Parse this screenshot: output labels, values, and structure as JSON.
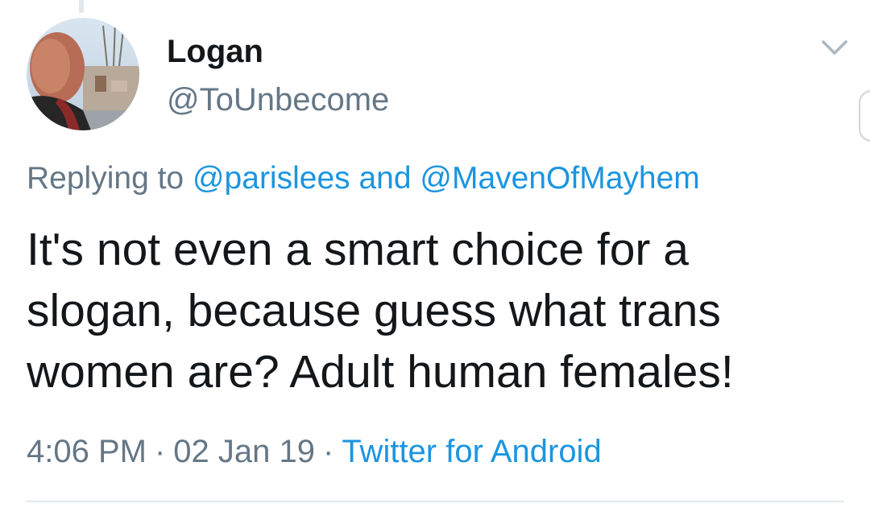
{
  "tweet": {
    "author": {
      "display_name": "Logan",
      "handle": "@ToUnbecome",
      "avatar_icon": "avatar-photo"
    },
    "menu_icon": "chevron-down-icon",
    "replying": {
      "prefix": "Replying to",
      "mention_1": "@parislees",
      "conjunction": "and",
      "mention_2": "@MavenOfMayhem"
    },
    "text_lines": [
      "It's not even a smart choice for a",
      "slogan, because guess what trans",
      "women are? Adult human females!"
    ],
    "time": "4:06 PM",
    "separator": "·",
    "date": "02 Jan 19",
    "source": "Twitter for Android"
  },
  "colors": {
    "text": "#14171a",
    "secondary": "#657786",
    "link": "#1b95e0",
    "divider": "#e1e8ed"
  }
}
